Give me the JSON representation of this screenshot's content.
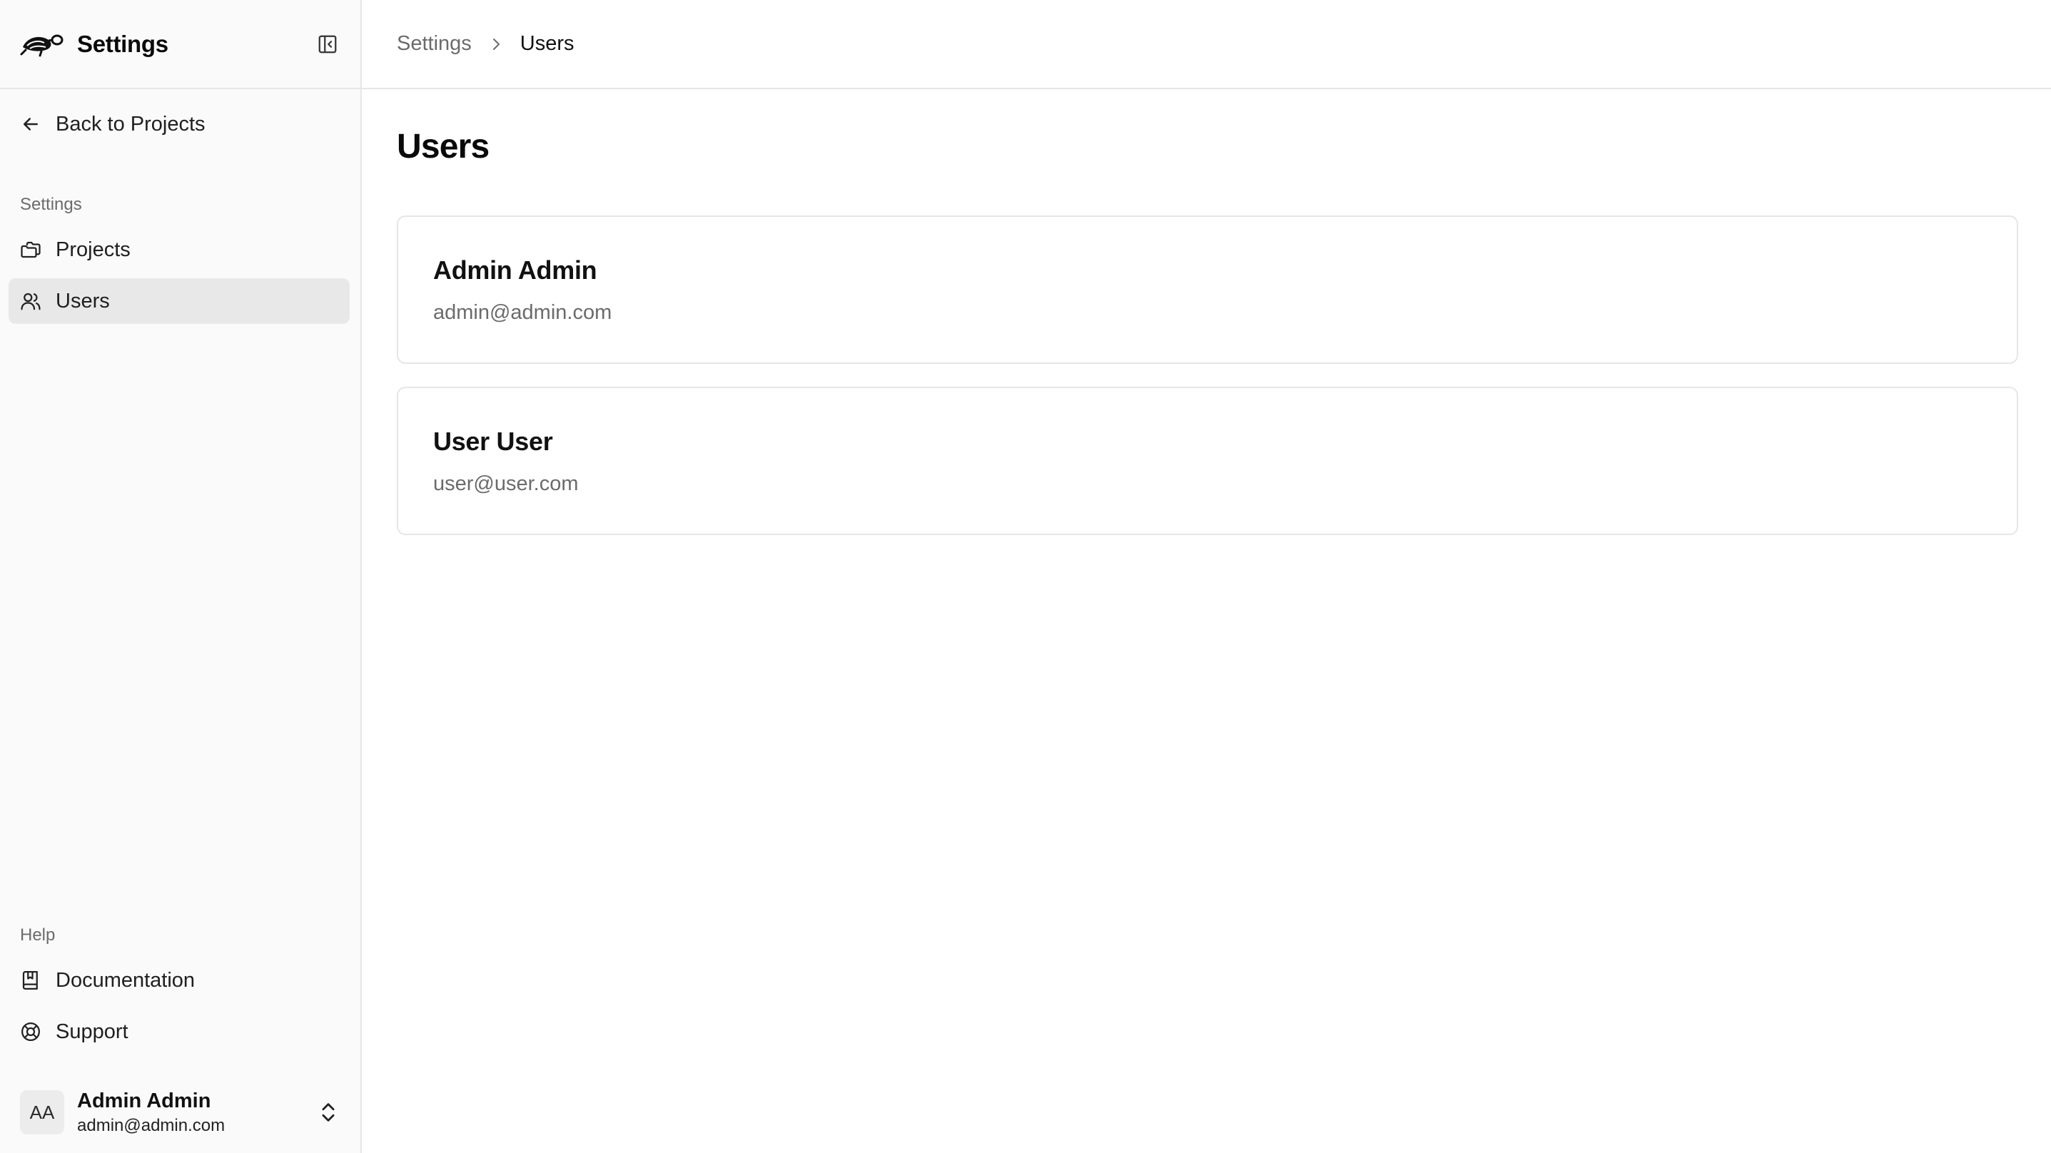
{
  "sidebar": {
    "title": "Settings",
    "back_label": "Back to Projects",
    "settings_group_label": "Settings",
    "settings_items": [
      {
        "label": "Projects",
        "icon": "folders-icon"
      },
      {
        "label": "Users",
        "icon": "users-icon",
        "active": true
      }
    ],
    "help_group_label": "Help",
    "help_items": [
      {
        "label": "Documentation",
        "icon": "book-icon"
      },
      {
        "label": "Support",
        "icon": "lifebuoy-icon"
      }
    ],
    "user": {
      "initials": "AA",
      "name": "Admin Admin",
      "email": "admin@admin.com"
    }
  },
  "breadcrumb": {
    "parent": "Settings",
    "current": "Users"
  },
  "page": {
    "title": "Users"
  },
  "users": [
    {
      "name": "Admin Admin",
      "email": "admin@admin.com"
    },
    {
      "name": "User User",
      "email": "user@user.com"
    }
  ]
}
